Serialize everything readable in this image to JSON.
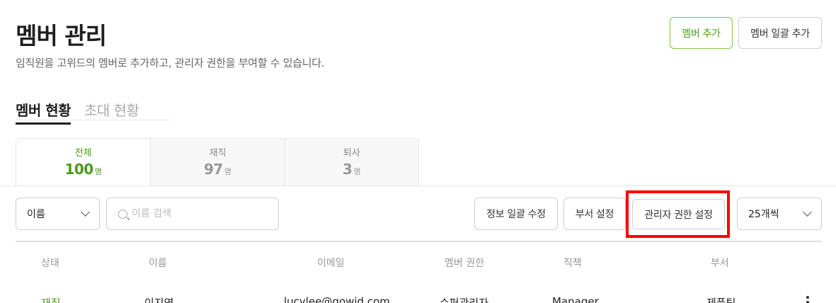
{
  "header": {
    "title": "멤버 관리",
    "description": "임직원을 고위드의 멤버로 추가하고, 관리자 권한을 부여할 수 있습니다.",
    "add_member_label": "멤버 추가",
    "bulk_add_label": "멤버 일괄 추가"
  },
  "tabs": [
    {
      "label": "멤버 현황",
      "active": true
    },
    {
      "label": "초대 현황",
      "active": false
    }
  ],
  "stats": [
    {
      "label": "전체",
      "value": "100",
      "unit": "명",
      "active": true
    },
    {
      "label": "재직",
      "value": "97",
      "unit": "명",
      "active": false
    },
    {
      "label": "퇴사",
      "value": "3",
      "unit": "명",
      "active": false
    }
  ],
  "toolbar": {
    "search_field_selected": "이름",
    "search_placeholder": "이름 검색",
    "bulk_edit_label": "정보 일괄 수정",
    "dept_settings_label": "부서 설정",
    "admin_rights_label": "관리자 권한 설정",
    "page_size_selected": "25개씩"
  },
  "table": {
    "columns": [
      "상태",
      "이름",
      "이메일",
      "멤버 권한",
      "직책",
      "부서"
    ],
    "rows": [
      {
        "status": "재직",
        "name": "이지영",
        "email": "lucylee@gowid.com",
        "role": "슈퍼관리자",
        "position": "Manager",
        "department": "제품팀"
      }
    ]
  },
  "colors": {
    "accent_green": "#4a9b1a",
    "highlight_red": "#ff0000"
  }
}
